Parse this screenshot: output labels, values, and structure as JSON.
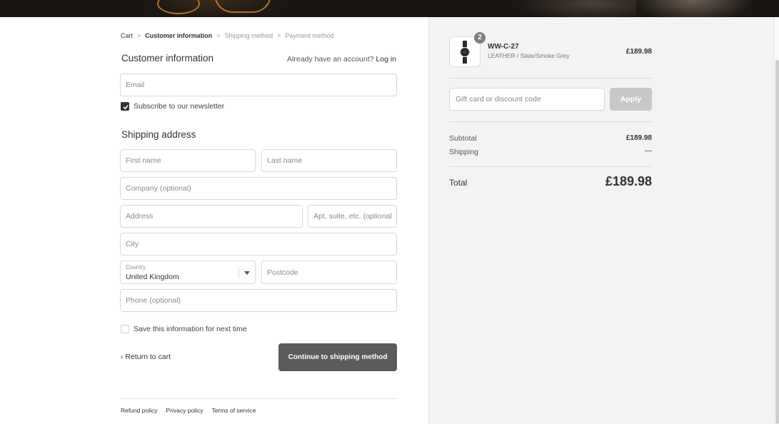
{
  "breadcrumb": {
    "items": [
      "Cart",
      "Customer information",
      "Shipping method",
      "Payment method"
    ]
  },
  "customer": {
    "title": "Customer information",
    "login_prompt": "Already have an account?",
    "login_link": "Log in",
    "email_placeholder": "Email",
    "newsletter_label": "Subscribe to our newsletter",
    "newsletter_checked": true
  },
  "shipping": {
    "title": "Shipping address",
    "first_name_placeholder": "First name",
    "last_name_placeholder": "Last name",
    "company_placeholder": "Company (optional)",
    "address_placeholder": "Address",
    "apt_placeholder": "Apt, suite, etc. (optional)",
    "city_placeholder": "City",
    "country_label": "Country",
    "country_value": "United Kingdom",
    "postcode_placeholder": "Postcode",
    "phone_placeholder": "Phone (optional)",
    "save_info_label": "Save this information for next time",
    "save_info_checked": false
  },
  "actions": {
    "return_label": "Return to cart",
    "continue_label": "Continue to shipping method"
  },
  "footer": {
    "links": [
      "Refund policy",
      "Privacy policy",
      "Terms of service"
    ]
  },
  "order": {
    "product": {
      "name": "WW-C-27",
      "variant": "LEATHER / Slate/Smoke Grey",
      "price": "£189.98",
      "quantity": "2"
    },
    "discount_placeholder": "Gift card or discount code",
    "apply_label": "Apply",
    "subtotal_label": "Subtotal",
    "subtotal_value": "£189.98",
    "shipping_label": "Shipping",
    "shipping_value": "—",
    "total_label": "Total",
    "total_value": "£189.98"
  },
  "colors": {
    "primary_button": "#5b5b5b",
    "apply_disabled": "#c8c8c8",
    "sidebar_bg": "#f3f3f3"
  }
}
